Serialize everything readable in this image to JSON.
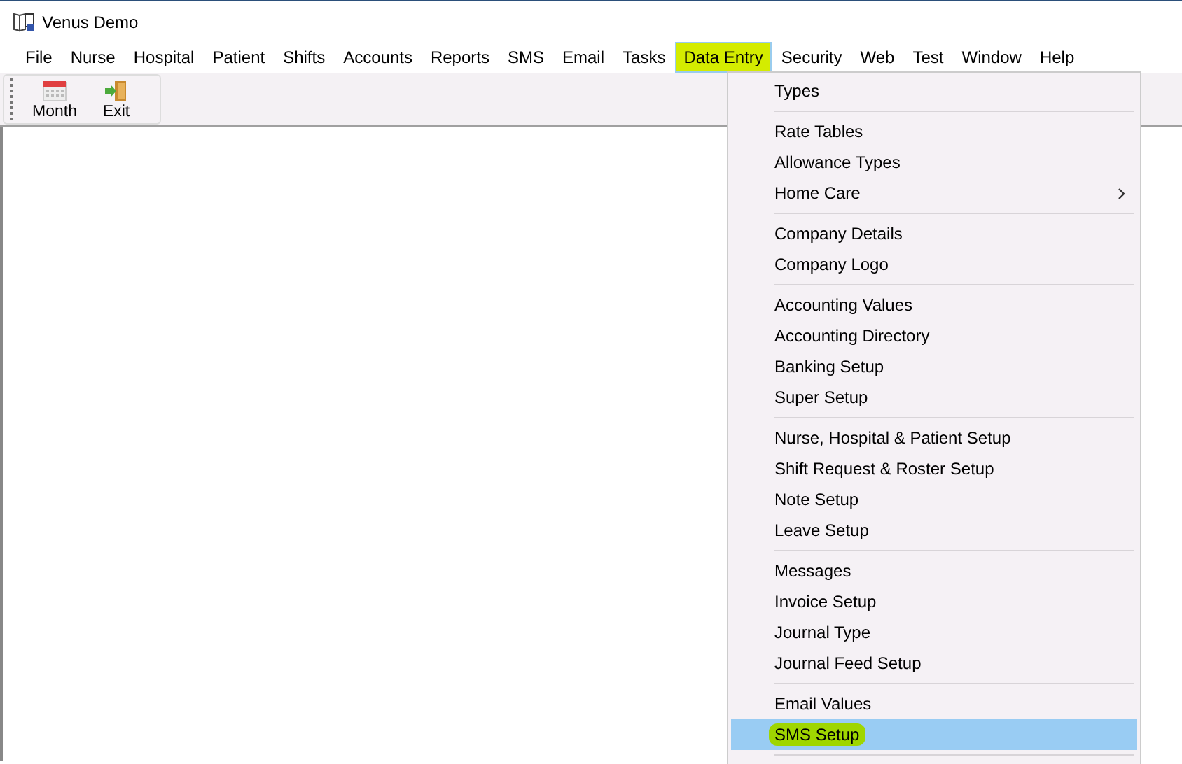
{
  "window": {
    "title": "Venus Demo"
  },
  "menu_bar": [
    {
      "label": "File",
      "selected": false
    },
    {
      "label": "Nurse",
      "selected": false
    },
    {
      "label": "Hospital",
      "selected": false
    },
    {
      "label": "Patient",
      "selected": false
    },
    {
      "label": "Shifts",
      "selected": false
    },
    {
      "label": "Accounts",
      "selected": false
    },
    {
      "label": "Reports",
      "selected": false
    },
    {
      "label": "SMS",
      "selected": false
    },
    {
      "label": "Email",
      "selected": false
    },
    {
      "label": "Tasks",
      "selected": false
    },
    {
      "label": "Data Entry",
      "selected": true
    },
    {
      "label": "Security",
      "selected": false
    },
    {
      "label": "Web",
      "selected": false
    },
    {
      "label": "Test",
      "selected": false
    },
    {
      "label": "Window",
      "selected": false
    },
    {
      "label": "Help",
      "selected": false
    }
  ],
  "toolbar": [
    {
      "label": "Month",
      "kind": "calendar"
    },
    {
      "label": "Exit",
      "kind": "exit"
    }
  ],
  "dropdown": [
    [
      {
        "label": "Types",
        "selected": false,
        "submenu": false
      }
    ],
    [
      {
        "label": "Rate Tables",
        "selected": false,
        "submenu": false
      },
      {
        "label": "Allowance Types",
        "selected": false,
        "submenu": false
      },
      {
        "label": "Home Care",
        "selected": false,
        "submenu": true
      }
    ],
    [
      {
        "label": "Company Details",
        "selected": false,
        "submenu": false
      },
      {
        "label": "Company Logo",
        "selected": false,
        "submenu": false
      }
    ],
    [
      {
        "label": "Accounting Values",
        "selected": false,
        "submenu": false
      },
      {
        "label": "Accounting Directory",
        "selected": false,
        "submenu": false
      },
      {
        "label": "Banking Setup",
        "selected": false,
        "submenu": false
      },
      {
        "label": "Super Setup",
        "selected": false,
        "submenu": false
      }
    ],
    [
      {
        "label": "Nurse, Hospital & Patient Setup",
        "selected": false,
        "submenu": false
      },
      {
        "label": "Shift Request & Roster Setup",
        "selected": false,
        "submenu": false
      },
      {
        "label": "Note Setup",
        "selected": false,
        "submenu": false
      },
      {
        "label": "Leave Setup",
        "selected": false,
        "submenu": false
      }
    ],
    [
      {
        "label": "Messages",
        "selected": false,
        "submenu": false
      },
      {
        "label": "Invoice Setup",
        "selected": false,
        "submenu": false
      },
      {
        "label": "Journal Type",
        "selected": false,
        "submenu": false
      },
      {
        "label": "Journal Feed Setup",
        "selected": false,
        "submenu": false
      }
    ],
    [
      {
        "label": "Email Values",
        "selected": false,
        "submenu": false
      },
      {
        "label": "SMS Setup",
        "selected": true,
        "submenu": false
      }
    ]
  ]
}
